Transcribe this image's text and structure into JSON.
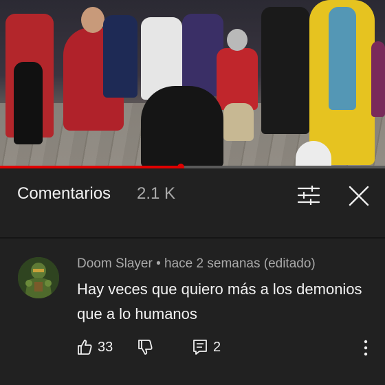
{
  "video": {
    "progress_fraction": 0.47
  },
  "comments_header": {
    "title": "Comentarios",
    "count": "2.1 K",
    "icons": [
      "filter-icon",
      "close-icon"
    ]
  },
  "comment": {
    "author": "Doom Slayer",
    "separator": " • ",
    "time": "hace 2 semanas (editado)",
    "text": "Hay veces que quiero más a los demonios que a lo humanos",
    "likes": "33",
    "replies": "2",
    "icons": [
      "like-icon",
      "dislike-icon",
      "reply-icon",
      "more-vertical-icon"
    ]
  },
  "colors": {
    "background": "#212121",
    "progress": "#e00000",
    "secondary_text": "#aaaaaa",
    "primary_text": "#f1f1f1"
  }
}
